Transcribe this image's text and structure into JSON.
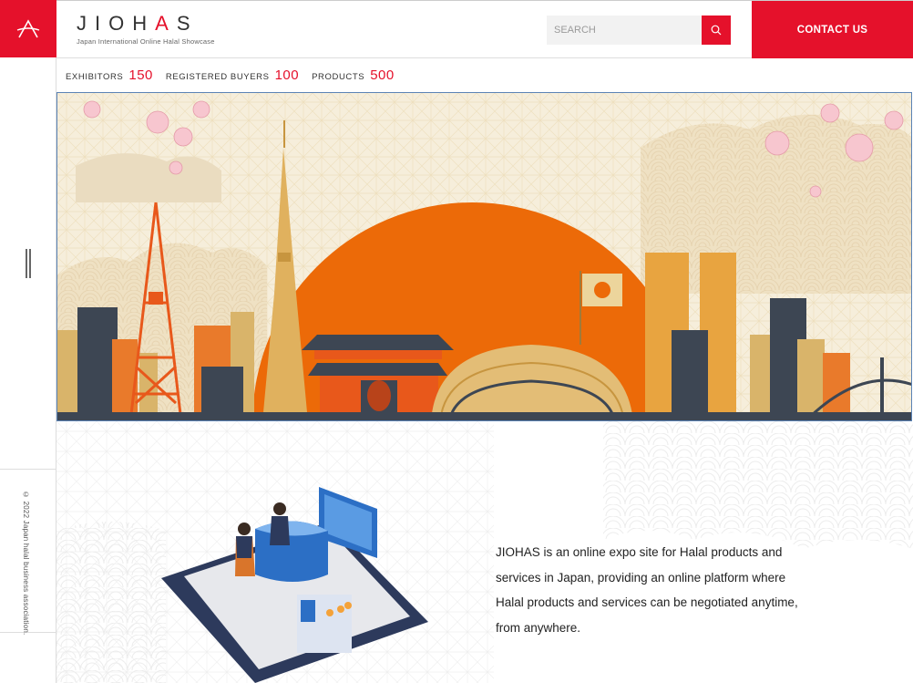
{
  "brand": {
    "logo_letter": "A",
    "name_pre": "JIOH",
    "name_accent": "A",
    "name_post": "S",
    "tagline": "Japan International Online Halal Showcase"
  },
  "search": {
    "placeholder": "SEARCH",
    "icon": "search-icon"
  },
  "contact": {
    "label": "CONTACT US"
  },
  "stats": [
    {
      "label": "EXHIBITORS",
      "value": "150"
    },
    {
      "label": "REGISTERED BUYERS",
      "value": "100"
    },
    {
      "label": "PRODUCTS",
      "value": "500"
    }
  ],
  "rail": {
    "copyright": "© 2022 Japan halal business association."
  },
  "about": {
    "text": "JIOHAS is an online expo site for Halal products and services in Japan, providing an online platform where Halal products and services can be negotiated anytime, from anywhere."
  },
  "colors": {
    "brand_red": "#e5112b",
    "sun_orange": "#ec6a08",
    "navy": "#2d3a5c"
  }
}
